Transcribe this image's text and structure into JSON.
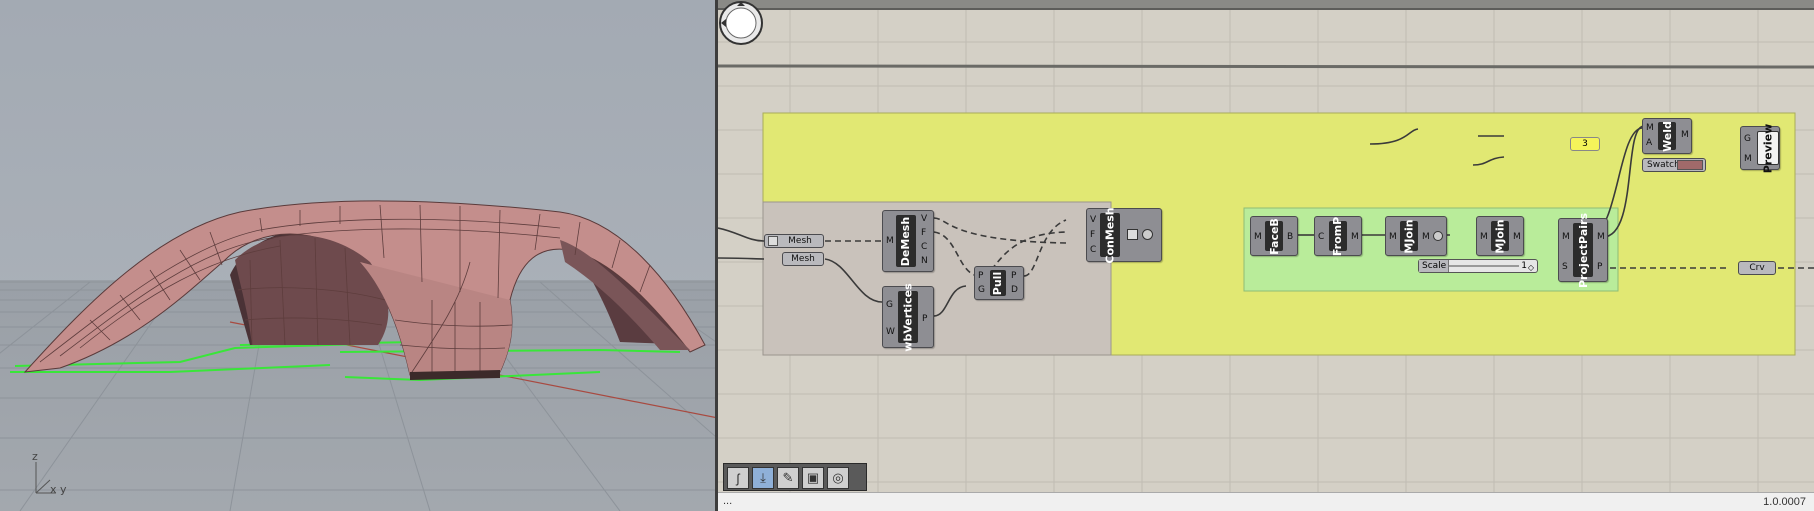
{
  "viewport": {
    "axis_z": "z",
    "axis_xy": "x y"
  },
  "canvas": {
    "components": {
      "mesh_param_1": "Mesh",
      "mesh_param_2": "Mesh",
      "demesh": {
        "name": "DeMesh",
        "inputs": [
          "M"
        ],
        "outputs": [
          "V",
          "F",
          "C",
          "N"
        ]
      },
      "wbvertices": {
        "name": "wbVertices",
        "inputs": [
          "G",
          "W"
        ],
        "outputs": [
          "P"
        ]
      },
      "pull": {
        "name": "Pull",
        "inputs": [
          "P",
          "G"
        ],
        "outputs": [
          "P",
          "D"
        ]
      },
      "conmesh": {
        "name": "ConMesh",
        "inputs": [
          "V",
          "F",
          "C"
        ],
        "outputs": []
      },
      "faceb": {
        "name": "FaceB",
        "inputs": [
          "M"
        ],
        "outputs": [
          "B"
        ]
      },
      "fromp": {
        "name": "FromP",
        "inputs": [
          "C"
        ],
        "outputs": [
          "M"
        ]
      },
      "mjoin1": {
        "name": "MJoin",
        "inputs": [
          "M"
        ],
        "outputs": [
          "M"
        ]
      },
      "mjoin2": {
        "name": "MJoin",
        "inputs": [
          "M"
        ],
        "outputs": [
          "M"
        ]
      },
      "projectpairs": {
        "name": "ProjectPairs",
        "inputs": [
          "M",
          "S"
        ],
        "outputs": [
          "M",
          "P"
        ]
      },
      "weld": {
        "name": "Weld",
        "inputs": [
          "M",
          "A"
        ],
        "outputs": [
          "M"
        ]
      },
      "preview": {
        "name": "Preview",
        "inputs": [
          "G",
          "M"
        ],
        "outputs": []
      },
      "swatch": "Swatch",
      "crv_param": "Crv",
      "panel_value": "3",
      "slider": {
        "label": "Scale",
        "value": "1"
      }
    },
    "colors": {
      "yellow_group": "#e1e873",
      "green_group": "#b9ec9a",
      "gray_group": "#c9c2bb",
      "swatch": "#a06a6a"
    }
  },
  "toolbar": {
    "icons": [
      "curve-icon",
      "bake-icon",
      "pen-icon",
      "box-icon",
      "sphere-icon"
    ]
  },
  "status": {
    "left": "...",
    "right": "1.0.0007"
  }
}
